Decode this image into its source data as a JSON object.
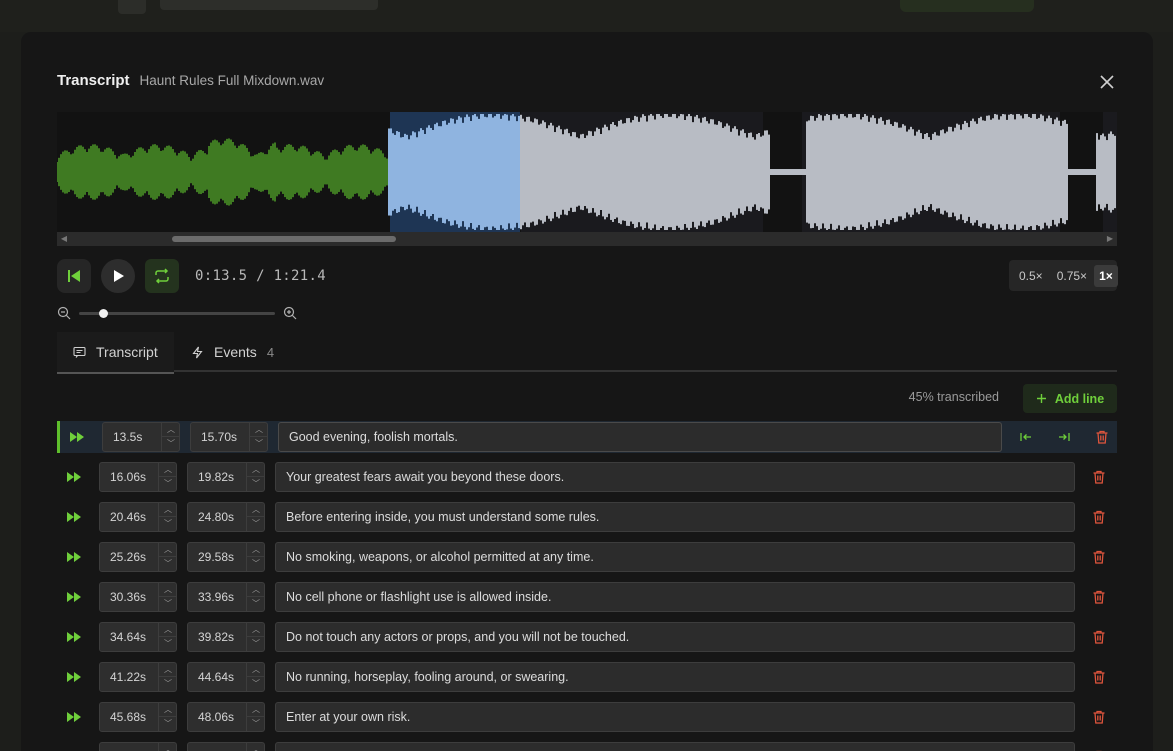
{
  "modal": {
    "title": "Transcript",
    "filename": "Haunt Rules Full Mixdown.wav"
  },
  "transport": {
    "current_time": "0:13.5",
    "separator": "/",
    "total_time": "1:21.4"
  },
  "speed": {
    "options": [
      "0.5×",
      "0.75×",
      "1×"
    ],
    "selected": "1×"
  },
  "zoom": {
    "level": 0.12
  },
  "tabs": [
    {
      "label": "Transcript",
      "count": ""
    },
    {
      "label": "Events",
      "count": "4"
    }
  ],
  "status": {
    "progress_text": "45% transcribed",
    "add_line_label": "Add line"
  },
  "lines": [
    {
      "start": "13.5s",
      "end": "15.70s",
      "text": "Good evening, foolish mortals."
    },
    {
      "start": "16.06s",
      "end": "19.82s",
      "text": "Your greatest fears await you beyond these doors."
    },
    {
      "start": "20.46s",
      "end": "24.80s",
      "text": "Before entering inside, you must understand some rules."
    },
    {
      "start": "25.26s",
      "end": "29.58s",
      "text": "No smoking, weapons, or alcohol permitted at any time."
    },
    {
      "start": "30.36s",
      "end": "33.96s",
      "text": "No cell phone or flashlight use is allowed inside."
    },
    {
      "start": "34.64s",
      "end": "39.82s",
      "text": "Do not touch any actors or props, and you will not be touched."
    },
    {
      "start": "41.22s",
      "end": "44.64s",
      "text": "No running, horseplay, fooling around, or swearing."
    },
    {
      "start": "45.68s",
      "end": "48.06s",
      "text": "Enter at your own risk."
    },
    {
      "start": "",
      "end": "",
      "text": ""
    }
  ],
  "colors": {
    "accent_green": "#6fcf3b",
    "selection_blue": "#8fb4e0",
    "wave_gray": "#b8bcc4",
    "trash_red": "#e0553d"
  }
}
